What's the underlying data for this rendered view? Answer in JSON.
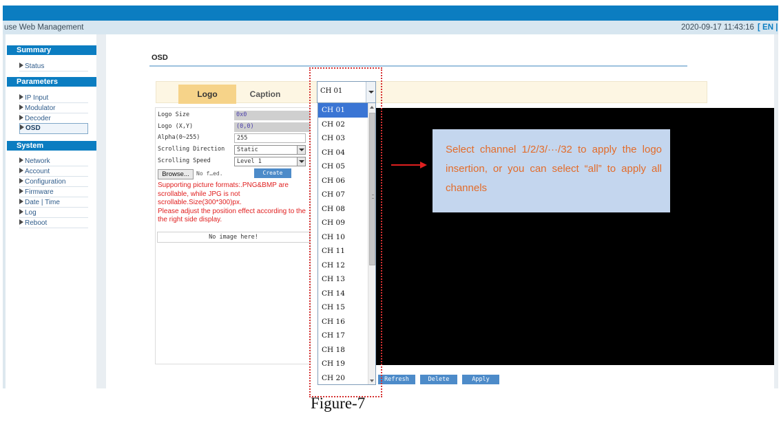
{
  "header": {
    "brand_text": "use Web Management",
    "datetime": "2020-09-17 11:43:16",
    "language": "[ EN |"
  },
  "sidebar": {
    "summary": {
      "title": "Summary",
      "items": [
        {
          "label": "Status"
        }
      ]
    },
    "parameters": {
      "title": "Parameters",
      "items": [
        {
          "label": "IP Input"
        },
        {
          "label": "Modulator"
        },
        {
          "label": "Decoder"
        },
        {
          "label": "OSD",
          "active": true
        }
      ]
    },
    "system": {
      "title": "System",
      "items": [
        {
          "label": "Network"
        },
        {
          "label": "Account"
        },
        {
          "label": "Configuration"
        },
        {
          "label": "Firmware"
        },
        {
          "label": "Date | Time"
        },
        {
          "label": "Log"
        },
        {
          "label": "Reboot"
        }
      ]
    }
  },
  "main": {
    "page_title": "OSD",
    "tabs": [
      {
        "label": "Logo",
        "active": true
      },
      {
        "label": "Caption",
        "active": false
      }
    ],
    "channel_select": {
      "value": "CH 01",
      "options": [
        "CH 01",
        "CH 02",
        "CH 03",
        "CH 04",
        "CH 05",
        "CH 06",
        "CH 07",
        "CH 08",
        "CH 09",
        "CH 10",
        "CH 11",
        "CH 12",
        "CH 13",
        "CH 14",
        "CH 15",
        "CH 16",
        "CH 17",
        "CH 18",
        "CH 19",
        "CH 20"
      ],
      "selected_index": 0
    },
    "form": {
      "logo_size_label": "Logo Size",
      "logo_size_value": "0x0",
      "logo_xy_label": "Logo (X,Y)",
      "logo_xy_value": "(0,0)",
      "alpha_label": "Alpha(0~255)",
      "alpha_value": "255",
      "scroll_dir_label": "Scrolling Direction",
      "scroll_dir_value": "Static",
      "scroll_speed_label": "Scrolling Speed",
      "scroll_speed_value": "Level 1",
      "browse_label": "Browse...",
      "no_file_text": "No f…ed.",
      "create_label": "Create",
      "support_text": "Supporting picture formats:.PNG&BMP are scrollable, while JPG is not scrollable.Size(300*300)px.",
      "adjust_text": "Please adjust the position effect according to the the right side display.",
      "no_image_text": "No image here!"
    },
    "actions": {
      "refresh_label": "Refresh",
      "delete_label": "Delete",
      "apply_label": "Apply"
    }
  },
  "annotation": {
    "callout_text": "Select channel 1/2/3/···/32 to apply the logo insertion, or you can select “all” to apply all channels",
    "figure_caption": "Figure-7"
  },
  "colors": {
    "topbar": "#0b7dc1",
    "active_tab": "#f6d389",
    "dropdown_selection": "#3a75d4",
    "callout_bg": "#c4d6ee",
    "callout_text": "#e36c2a",
    "annotation_red": "#e02020"
  }
}
